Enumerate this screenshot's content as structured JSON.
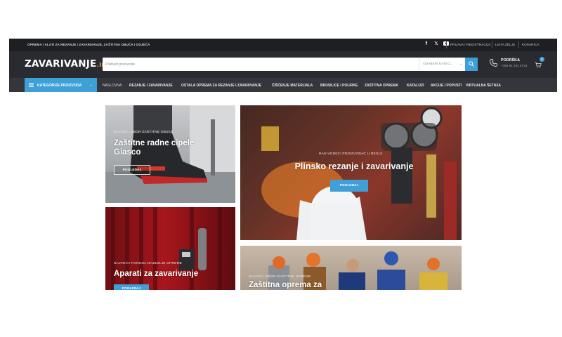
{
  "topbar": {
    "promo": "OPREMA I ALATI ZA REZANJE I ZAVARIVANJE, ZAŠTITNA OBUĆA I ODJEĆA",
    "social_icons": [
      "facebook-icon",
      "x-icon",
      "youtube-icon"
    ],
    "login_label": "PRIJAVA / REGISTRACIJA",
    "wishlist_label": "LISTA ŽELJA",
    "cart_label": "KOŠARICA"
  },
  "header": {
    "logo_main": "ZAVARIVANJE",
    "logo_tld": ".info",
    "search_placeholder": "Pretraži proizvode",
    "category_select": "ODABERI KATEG...",
    "support_label": "PODRŠKA",
    "support_phone": "+385 91 261 5713",
    "cart_count": "0"
  },
  "nav": {
    "categories_button": "KATEGORIJE PROIZVODA",
    "items": [
      "NASLOVNA",
      "REZANJE I ZAVARIVANJE",
      "OSTALA OPREMA ZA REZANJE I ZAVARIVANJE",
      "ČIŠĆENJE MATERIJALA",
      "BRUSILICE I POLIRKE",
      "ZAŠTITNA OPREMA",
      "KATALOZI",
      "AKCIJE I POPUSTI",
      "VIRTUALNA ŠETNJA"
    ]
  },
  "banners": {
    "shoes": {
      "sub": "NAJVEĆI IZBOR ZAŠTITNE OBUĆE",
      "title": "Zaštitne radne cipele Giasco",
      "button": "POGLEDAJ"
    },
    "gas": {
      "sub": "RAN VODEĆI PROIZVOĐAČ U REGIJI",
      "title": "Plinsko rezanje i zavarivanje",
      "button": "POGLEDAJ"
    },
    "welding": {
      "sub": "NAJVEĆA PONUDA NAJBOLJE OPREME",
      "title": "Aparati za zavarivanje",
      "button": "POGLEDAJ"
    },
    "protective": {
      "sub": "NAJVEĆI IZBOR ZAŠTITNE OPREME",
      "title": "Zaštitna oprema za"
    }
  },
  "colors": {
    "accent": "#3fa0d8",
    "topbar_bg": "#1e1f23",
    "header_bg": "#2a2b30",
    "nav_bg": "#35363b",
    "logo_tld": "#f0a12a"
  }
}
